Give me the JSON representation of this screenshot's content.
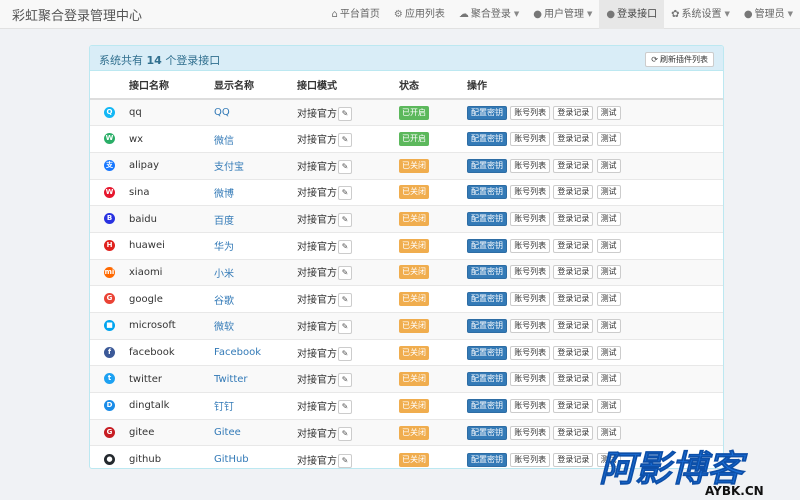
{
  "app": {
    "title": "彩虹聚合登录管理中心"
  },
  "nav": [
    {
      "label": "平台首页",
      "icon": "home-icon",
      "glyph": "⌂",
      "dropdown": false,
      "active": false
    },
    {
      "label": "应用列表",
      "icon": "apps-icon",
      "glyph": "⚙",
      "dropdown": false,
      "active": false
    },
    {
      "label": "聚合登录",
      "icon": "cloud-icon",
      "glyph": "☁",
      "dropdown": true,
      "active": false
    },
    {
      "label": "用户管理",
      "icon": "user-icon",
      "glyph": "●",
      "dropdown": true,
      "active": false
    },
    {
      "label": "登录接口",
      "icon": "circle-icon",
      "glyph": "●",
      "dropdown": false,
      "active": true
    },
    {
      "label": "系统设置",
      "icon": "gear-icon",
      "glyph": "✿",
      "dropdown": true,
      "active": false
    },
    {
      "label": "管理员",
      "icon": "admin-icon",
      "glyph": "●",
      "dropdown": true,
      "active": false
    }
  ],
  "panel": {
    "title_prefix": "系统共有",
    "count": "14",
    "title_suffix": "个登录接口",
    "refresh_label": "刷新插件列表"
  },
  "table": {
    "headers": [
      "接口名称",
      "显示名称",
      "接口模式",
      "状态",
      "操作"
    ],
    "mode_label": "对接官方",
    "actions": [
      "配置密钥",
      "账号列表",
      "登录记录",
      "测试"
    ],
    "rows": [
      {
        "name": "qq",
        "display": "QQ",
        "status": "已开启",
        "enabled": true,
        "icon": "qq-icon",
        "color": "#12b7f5",
        "glyph": "Q"
      },
      {
        "name": "wx",
        "display": "微信",
        "status": "已开启",
        "enabled": true,
        "icon": "wechat-icon",
        "color": "#2aae67",
        "glyph": "W"
      },
      {
        "name": "alipay",
        "display": "支付宝",
        "status": "已关闭",
        "enabled": false,
        "icon": "alipay-icon",
        "color": "#1677ff",
        "glyph": "支"
      },
      {
        "name": "sina",
        "display": "微博",
        "status": "已关闭",
        "enabled": false,
        "icon": "weibo-icon",
        "color": "#e6162d",
        "glyph": "W"
      },
      {
        "name": "baidu",
        "display": "百度",
        "status": "已关闭",
        "enabled": false,
        "icon": "baidu-icon",
        "color": "#2932e1",
        "glyph": "B"
      },
      {
        "name": "huawei",
        "display": "华为",
        "status": "已关闭",
        "enabled": false,
        "icon": "huawei-icon",
        "color": "#e0221e",
        "glyph": "H"
      },
      {
        "name": "xiaomi",
        "display": "小米",
        "status": "已关闭",
        "enabled": false,
        "icon": "xiaomi-icon",
        "color": "#ff6900",
        "glyph": "mi"
      },
      {
        "name": "google",
        "display": "谷歌",
        "status": "已关闭",
        "enabled": false,
        "icon": "google-icon",
        "color": "#ea4335",
        "glyph": "G"
      },
      {
        "name": "microsoft",
        "display": "微软",
        "status": "已关闭",
        "enabled": false,
        "icon": "microsoft-icon",
        "color": "#00a4ef",
        "glyph": "■"
      },
      {
        "name": "facebook",
        "display": "Facebook",
        "status": "已关闭",
        "enabled": false,
        "icon": "facebook-icon",
        "color": "#3b5998",
        "glyph": "f"
      },
      {
        "name": "twitter",
        "display": "Twitter",
        "status": "已关闭",
        "enabled": false,
        "icon": "twitter-icon",
        "color": "#1da1f2",
        "glyph": "t"
      },
      {
        "name": "dingtalk",
        "display": "钉钉",
        "status": "已关闭",
        "enabled": false,
        "icon": "dingtalk-icon",
        "color": "#1a8ce8",
        "glyph": "D"
      },
      {
        "name": "gitee",
        "display": "Gitee",
        "status": "已关闭",
        "enabled": false,
        "icon": "gitee-icon",
        "color": "#c71d23",
        "glyph": "G"
      },
      {
        "name": "github",
        "display": "GitHub",
        "status": "已关闭",
        "enabled": false,
        "icon": "github-icon",
        "color": "#24292e",
        "glyph": "●"
      }
    ]
  },
  "watermark": {
    "main": "阿影博客",
    "sub": "AYBK.CN",
    "color": "#1a6fd8"
  }
}
